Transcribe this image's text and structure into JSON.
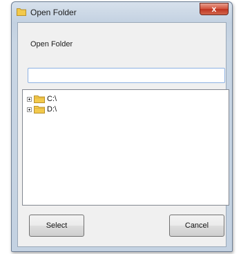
{
  "window": {
    "title": "Open Folder",
    "close_label": "x"
  },
  "dialog": {
    "prompt": "Open Folder",
    "path_value": "",
    "path_placeholder": ""
  },
  "tree": {
    "items": [
      {
        "label": "C:\\",
        "icon": "folder-icon"
      },
      {
        "label": "D:\\",
        "icon": "folder-icon"
      }
    ]
  },
  "buttons": {
    "select_label": "Select",
    "cancel_label": "Cancel"
  },
  "colors": {
    "titlebar": "#c3d1e1",
    "close_button": "#c7402b",
    "folder": "#f2c94c",
    "input_border": "#8db2e3"
  }
}
